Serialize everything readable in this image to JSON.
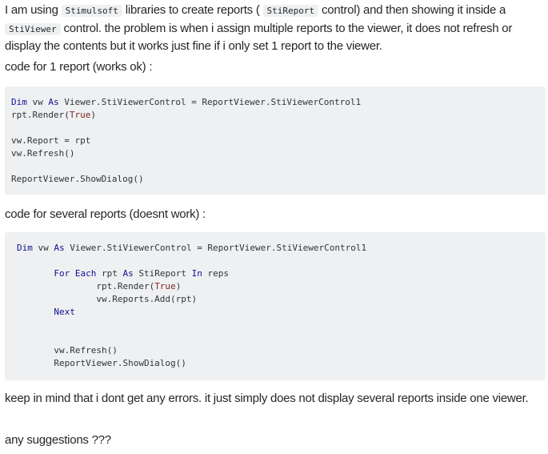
{
  "post": {
    "intro": {
      "text_1": "I am using ",
      "code_stimulsoft": "Stimulsoft",
      "text_2": " libraries to create reports ( ",
      "code_stireport": "StiReport",
      "text_3": " control) and then showing it inside a ",
      "code_stiviewer": "StiViewer",
      "text_4": " control. the problem is when i assign multiple reports to the viewer, it does not refresh or display the contents but it works just fine if i only set 1 report to the viewer."
    },
    "label_single": "code for 1 report (works ok) :",
    "code_single": {
      "lines": [
        [
          {
            "t": "Dim",
            "k": "kw"
          },
          {
            "t": " vw ",
            "k": ""
          },
          {
            "t": "As",
            "k": "kw"
          },
          {
            "t": " Viewer.StiViewerControl = ReportViewer.StiViewerControl1",
            "k": ""
          }
        ],
        [
          {
            "t": "rpt.Render(",
            "k": ""
          },
          {
            "t": "True",
            "k": "lit"
          },
          {
            "t": ")",
            "k": ""
          }
        ],
        [],
        [
          {
            "t": "vw.Report = rpt",
            "k": ""
          }
        ],
        [
          {
            "t": "vw.Refresh()",
            "k": ""
          }
        ],
        [],
        [
          {
            "t": "ReportViewer.ShowDialog()",
            "k": ""
          }
        ]
      ]
    },
    "label_multi": "code for several reports (doesnt work) :",
    "code_multi": {
      "lines": [
        [
          {
            "t": "Dim",
            "k": "kw"
          },
          {
            "t": " vw ",
            "k": ""
          },
          {
            "t": "As",
            "k": "kw"
          },
          {
            "t": " Viewer.StiViewerControl = ReportViewer.StiViewerControl1",
            "k": ""
          }
        ],
        [],
        [
          {
            "t": "       ",
            "k": ""
          },
          {
            "t": "For",
            "k": "kw"
          },
          {
            "t": " ",
            "k": ""
          },
          {
            "t": "Each",
            "k": "kw"
          },
          {
            "t": " rpt ",
            "k": ""
          },
          {
            "t": "As",
            "k": "kw"
          },
          {
            "t": " StiReport ",
            "k": ""
          },
          {
            "t": "In",
            "k": "kw"
          },
          {
            "t": " reps",
            "k": ""
          }
        ],
        [
          {
            "t": "               rpt.Render(",
            "k": ""
          },
          {
            "t": "True",
            "k": "lit"
          },
          {
            "t": ")",
            "k": ""
          }
        ],
        [
          {
            "t": "               vw.Reports.Add(rpt)",
            "k": ""
          }
        ],
        [
          {
            "t": "       ",
            "k": ""
          },
          {
            "t": "Next",
            "k": "kw"
          }
        ],
        [],
        [],
        [
          {
            "t": "       vw.Refresh()",
            "k": ""
          }
        ],
        [
          {
            "t": "       ReportViewer.ShowDialog()",
            "k": ""
          }
        ]
      ]
    },
    "closing": "keep in mind that i dont get any errors. it just simply does not display several reports inside one viewer.",
    "question": "any suggestions ???"
  }
}
